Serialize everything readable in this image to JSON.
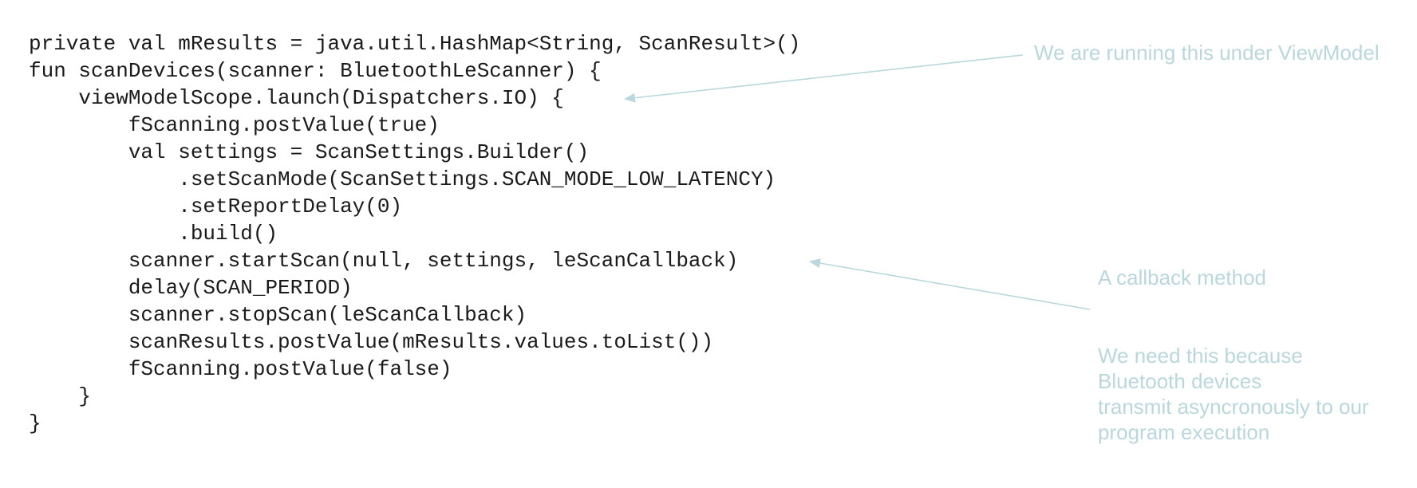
{
  "colors": {
    "code_text": "#1a1a1a",
    "annotation_text": "#b9d7dc",
    "arrow": "#b9d7dc",
    "background": "#ffffff"
  },
  "code": {
    "lines": [
      "private val mResults = java.util.HashMap<String, ScanResult>()",
      "fun scanDevices(scanner: BluetoothLeScanner) {",
      "    viewModelScope.launch(Dispatchers.IO) {",
      "        fScanning.postValue(true)",
      "        val settings = ScanSettings.Builder()",
      "            .setScanMode(ScanSettings.SCAN_MODE_LOW_LATENCY)",
      "            .setReportDelay(0)",
      "            .build()",
      "        scanner.startScan(null, settings, leScanCallback)",
      "        delay(SCAN_PERIOD)",
      "        scanner.stopScan(leScanCallback)",
      "        scanResults.postValue(mResults.values.toList())",
      "        fScanning.postValue(false)",
      "    }",
      "}"
    ]
  },
  "annotations": {
    "viewmodel": "We are running this under ViewModel",
    "callback": "A callback method",
    "async": "We need this because\nBluetooth devices\ntransmit asyncronously to our\nprogram execution"
  }
}
